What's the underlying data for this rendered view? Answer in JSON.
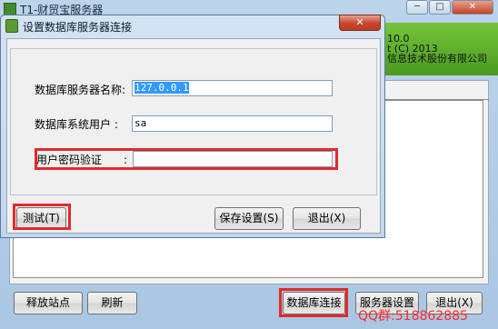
{
  "background_window": {
    "title": "T1-财贸宝服务器",
    "minimize_glyph": "─",
    "maximize_glyph": "□",
    "close_glyph": "✕",
    "banner": {
      "version": "10.0",
      "copyright": "t (C) 2013",
      "company": "信息技术股份有限公司"
    },
    "buttons": {
      "release_site": "释放站点",
      "refresh": "刷新",
      "db_connect": "数据库连接",
      "server_settings": "服务器设置",
      "exit": "退出(X)"
    },
    "watermark": "QQ群:518862885"
  },
  "dialog": {
    "title": "设置数据库服务器连接",
    "close_glyph": "✕",
    "fields": {
      "server_name_label": "数据库服务器名称:",
      "server_name_value": "127.0.0.1",
      "system_user_label": "数据库系统用户 :",
      "system_user_value": "sa",
      "password_label": "用户密码验证",
      "password_colon": ":",
      "password_value": ""
    },
    "buttons": {
      "test": "测试(T)",
      "save": "保存设置(S)",
      "exit": "退出(X)"
    }
  },
  "highlight_color": "#e12a2a"
}
